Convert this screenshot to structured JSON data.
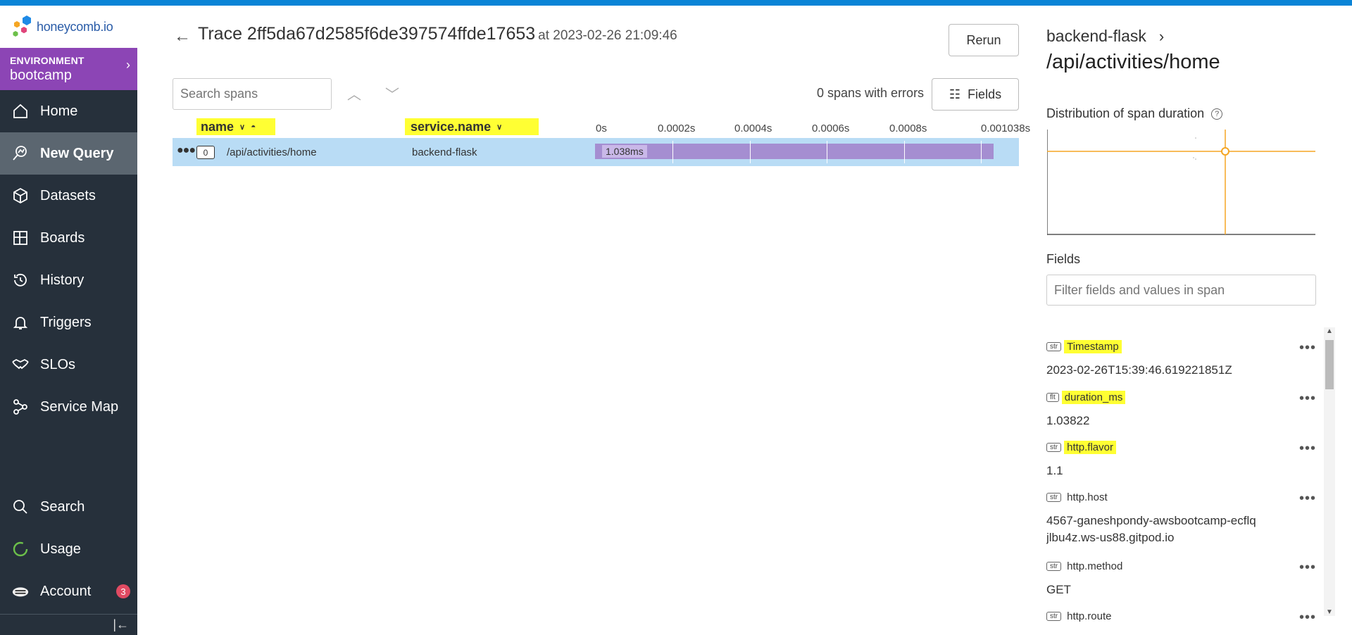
{
  "app": {
    "logo_text": "honeycomb.io",
    "environment_label": "ENVIRONMENT",
    "environment_name": "bootcamp"
  },
  "sidebar": {
    "items": [
      {
        "label": "Home",
        "icon": "home-icon"
      },
      {
        "label": "New Query",
        "icon": "query-icon",
        "active": true
      },
      {
        "label": "Datasets",
        "icon": "cube-icon"
      },
      {
        "label": "Boards",
        "icon": "boards-icon"
      },
      {
        "label": "History",
        "icon": "history-icon"
      },
      {
        "label": "Triggers",
        "icon": "bell-icon"
      },
      {
        "label": "SLOs",
        "icon": "handshake-icon"
      },
      {
        "label": "Service Map",
        "icon": "graph-icon"
      }
    ],
    "bottom_items": [
      {
        "label": "Search",
        "icon": "search-icon"
      },
      {
        "label": "Usage",
        "icon": "usage-icon"
      },
      {
        "label": "Account",
        "icon": "bee-icon",
        "badge": "3"
      }
    ]
  },
  "trace": {
    "title": "Trace 2ff5da67d2585f6de397574ffde17653",
    "at": "at 2023-02-26 21:09:46",
    "rerun_label": "Rerun",
    "search_placeholder": "Search spans",
    "errors_text": "0 spans with errors",
    "fields_label": "Fields",
    "columns": {
      "name": "name",
      "service": "service.name"
    },
    "ticks": [
      "0s",
      "0.0002s",
      "0.0004s",
      "0.0006s",
      "0.0008s",
      "0.001038s"
    ],
    "spans": [
      {
        "index": "0",
        "name": "/api/activities/home",
        "service": "backend-flask",
        "duration_label": "1.038ms",
        "duration_fraction": 1.0
      }
    ]
  },
  "detail": {
    "service": "backend-flask",
    "endpoint": "/api/activities/home",
    "distribution_title": "Distribution of span duration",
    "fields_title": "Fields",
    "filter_placeholder": "Filter fields and values in span",
    "fields": [
      {
        "type": "str",
        "name": "Timestamp",
        "value": "2023-02-26T15:39:46.619221851Z",
        "highlight": true
      },
      {
        "type": "flt",
        "name": "duration_ms",
        "value": "1.03822",
        "highlight": true
      },
      {
        "type": "str",
        "name": "http.flavor",
        "value": "1.1",
        "highlight": true
      },
      {
        "type": "str",
        "name": "http.host",
        "value": "4567-ganeshpondy-awsbootcamp-ecflqjlbu4z.ws-us88.gitpod.io",
        "highlight": false
      },
      {
        "type": "str",
        "name": "http.method",
        "value": "GET",
        "highlight": false
      },
      {
        "type": "str",
        "name": "http.route",
        "value": "",
        "highlight": false
      }
    ]
  },
  "colors": {
    "accent": "#0a84d6",
    "sidebar_bg": "#26303b",
    "environment_bg": "#8c45b5",
    "row_highlight": "#b9dcf5",
    "span_bar": "#a58ed1",
    "chart_line": "#f5a623",
    "highlight": "#ffff33"
  }
}
